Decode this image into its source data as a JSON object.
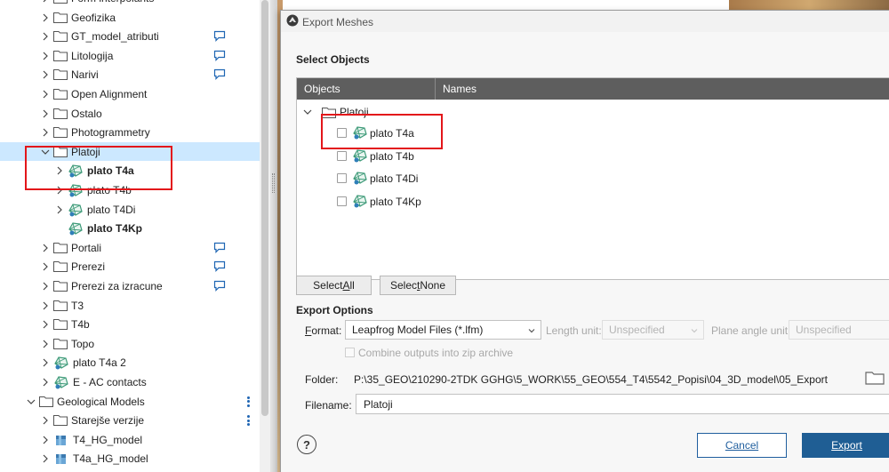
{
  "tree": {
    "items": [
      {
        "label": "Form interpolants",
        "level": 1,
        "type": "folder",
        "expand": "collapsed",
        "comment": false
      },
      {
        "label": "Geofizika",
        "level": 1,
        "type": "folder",
        "expand": "collapsed",
        "comment": false
      },
      {
        "label": "GT_model_atributi",
        "level": 1,
        "type": "folder",
        "expand": "collapsed",
        "comment": true
      },
      {
        "label": "Litologija",
        "level": 1,
        "type": "folder",
        "expand": "collapsed",
        "comment": true
      },
      {
        "label": "Narivi",
        "level": 1,
        "type": "folder",
        "expand": "collapsed",
        "comment": true
      },
      {
        "label": "Open Alignment",
        "level": 1,
        "type": "folder",
        "expand": "collapsed",
        "comment": false
      },
      {
        "label": "Ostalo",
        "level": 1,
        "type": "folder",
        "expand": "collapsed",
        "comment": false
      },
      {
        "label": "Photogrammetry",
        "level": 1,
        "type": "folder",
        "expand": "collapsed",
        "comment": false
      },
      {
        "label": "Platoji",
        "level": 1,
        "type": "folder",
        "expand": "expanded",
        "comment": false,
        "selected": true
      },
      {
        "label": "plato T4a",
        "level": 2,
        "type": "mesh",
        "expand": "collapsed",
        "comment": false,
        "bold": true
      },
      {
        "label": "plato T4b",
        "level": 2,
        "type": "mesh",
        "expand": "collapsed",
        "comment": false
      },
      {
        "label": "plato T4Di",
        "level": 2,
        "type": "mesh",
        "expand": "collapsed",
        "comment": false
      },
      {
        "label": "plato T4Kp",
        "level": 2,
        "type": "mesh",
        "expand": "none",
        "comment": false,
        "bold": true
      },
      {
        "label": "Portali",
        "level": 1,
        "type": "folder",
        "expand": "collapsed",
        "comment": true
      },
      {
        "label": "Prerezi",
        "level": 1,
        "type": "folder",
        "expand": "collapsed",
        "comment": true
      },
      {
        "label": "Prerezi za izracune",
        "level": 1,
        "type": "folder",
        "expand": "collapsed",
        "comment": true
      },
      {
        "label": "T3",
        "level": 1,
        "type": "folder",
        "expand": "collapsed",
        "comment": false
      },
      {
        "label": "T4b",
        "level": 1,
        "type": "folder",
        "expand": "collapsed",
        "comment": false
      },
      {
        "label": "Topo",
        "level": 1,
        "type": "folder",
        "expand": "collapsed",
        "comment": false
      },
      {
        "label": "plato T4a 2",
        "level": 1,
        "type": "mesh",
        "expand": "collapsed",
        "comment": false
      },
      {
        "label": "E - AC contacts",
        "level": 1,
        "type": "mesh",
        "expand": "collapsed",
        "comment": false
      },
      {
        "label": "Geological Models",
        "level": 0,
        "type": "folder",
        "expand": "expanded",
        "comment": false,
        "kebab": true
      },
      {
        "label": "Starejše verzije",
        "level": 1,
        "type": "folder",
        "expand": "collapsed",
        "comment": false,
        "kebab": true
      },
      {
        "label": "T4_HG_model",
        "level": 1,
        "type": "model",
        "expand": "collapsed",
        "comment": false
      },
      {
        "label": "T4a_HG_model",
        "level": 1,
        "type": "model",
        "expand": "collapsed",
        "comment": false
      }
    ]
  },
  "dialog": {
    "title": "Export Meshes",
    "select_objects_heading": "Select Objects",
    "columns": [
      "Objects",
      "Names"
    ],
    "parent_folder": "Platoji",
    "objects": [
      "plato T4a",
      "plato T4b",
      "plato T4Di",
      "plato T4Kp"
    ],
    "select_all": {
      "pre": "Select ",
      "key": "A",
      "post": "ll"
    },
    "select_none": {
      "pre": "Selec",
      "key": "t",
      "post": " None"
    },
    "export_options_heading": "Export Options",
    "format_label": {
      "key": "F",
      "rest": "ormat:"
    },
    "format_value": "Leapfrog Model Files (*.lfm)",
    "length_unit_label": "Length unit:",
    "length_unit_value": "Unspecified",
    "plane_angle_label": "Plane angle unit:",
    "plane_angle_value": "Unspecified",
    "combine_label": "Combine outputs into zip archive",
    "folder_label": "Folder:",
    "folder_value": "P:\\35_GEO\\210290-2TDK GGHG\\5_WORK\\55_GEO\\554_T4\\5542_Popisi\\04_3D_model\\05_Export",
    "filename_label": "Filename:",
    "filename_value": "Platoji",
    "help_label": "?",
    "cancel_label": "Cancel",
    "export_label": "Export"
  },
  "colors": {
    "selection": "#cce8ff",
    "header": "#5e5e5e",
    "accent": "#1f5e94",
    "highlight_box": "#e3161a",
    "comment_icon": "#1f66b3",
    "mesh_icon": "#3d9a78"
  }
}
